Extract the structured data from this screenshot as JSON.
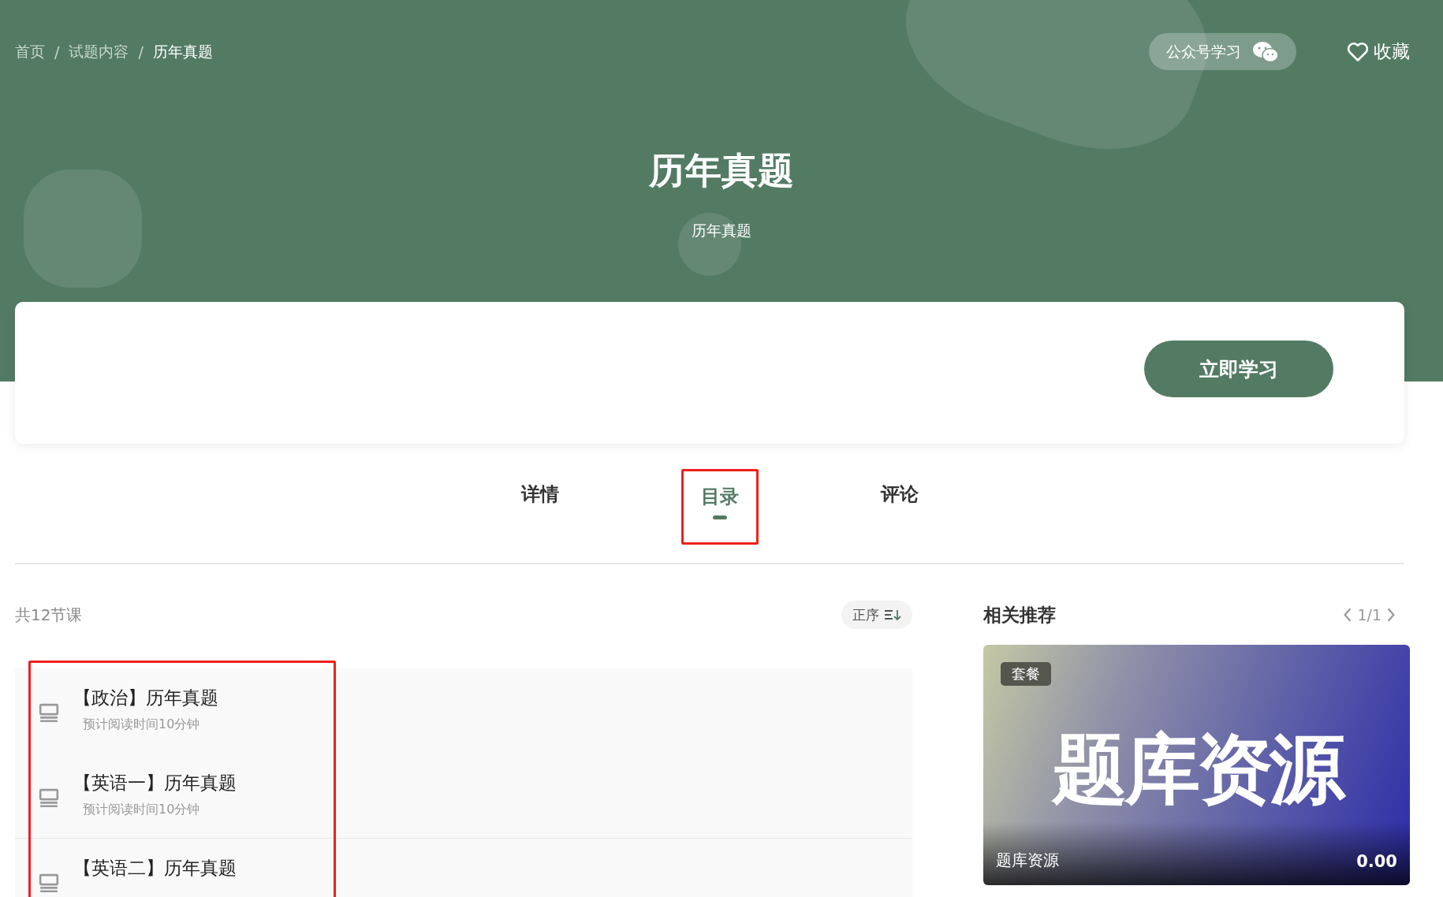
{
  "breadcrumb": [
    "首页",
    "试题内容",
    "历年真题"
  ],
  "breadcrumb_separator": "/",
  "header": {
    "wechat_button": "公众号学习",
    "favorite": "收藏",
    "title": "历年真题",
    "subtitle": "历年真题"
  },
  "start_button": "立即学习",
  "tabs": [
    {
      "label": "详情",
      "selected": false,
      "highlighted": false
    },
    {
      "label": "目录",
      "selected": true,
      "highlighted": true
    },
    {
      "label": "评论",
      "selected": false,
      "highlighted": false
    }
  ],
  "catalog": {
    "count": "共12节课",
    "sort": "正序",
    "highlighted": true,
    "lessons": [
      {
        "title": "【政治】历年真题",
        "meta": "预计阅读时间10分钟"
      },
      {
        "title": "【英语一】历年真题",
        "meta": "预计阅读时间10分钟"
      },
      {
        "title": "【英语二】历年真题"
      }
    ]
  },
  "related": {
    "title": "相关推荐",
    "pager": "1/1",
    "card": {
      "badge": "套餐",
      "cover_text": "题库资源",
      "name": "题库资源",
      "price": "0.00"
    }
  }
}
